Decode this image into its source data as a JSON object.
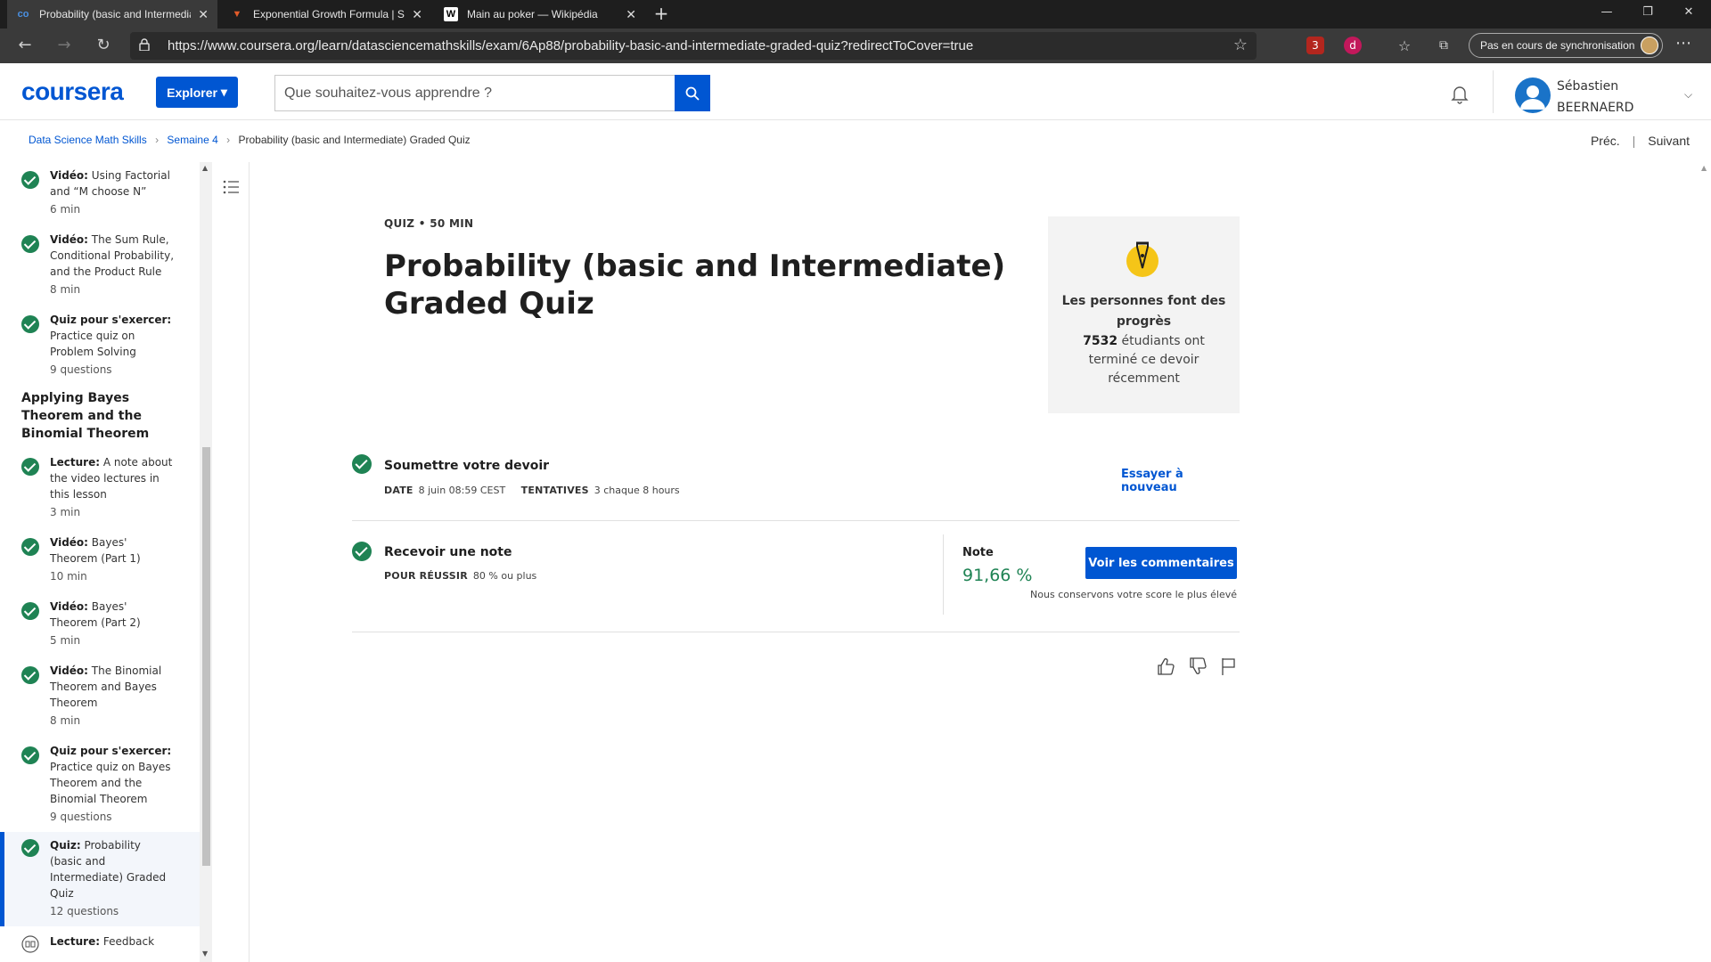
{
  "browser": {
    "tabs": [
      {
        "label": "Probability (basic and Intermedia",
        "favicon": "coursera-icon"
      },
      {
        "label": "Exponential Growth Formula | St",
        "favicon": "study-icon"
      },
      {
        "label": "Main au poker — Wikipédia",
        "favicon": "wikipedia-icon"
      }
    ],
    "url": "https://www.coursera.org/learn/datasciencemathskills/exam/6Ap88/probability-basic-and-intermediate-graded-quiz?redirectToCover=true",
    "extension_badge": "3",
    "sync_label": "Pas en cours de synchronisation"
  },
  "header": {
    "logo": "coursera",
    "explore_label": "Explorer",
    "search_placeholder": "Que souhaitez-vous apprendre ?",
    "user_first": "Sébastien",
    "user_last": "BEERNAERD"
  },
  "breadcrumb": {
    "course": "Data Science Math Skills",
    "week": "Semaine 4",
    "current": "Probability (basic and Intermediate) Graded Quiz"
  },
  "nav": {
    "prev": "Préc.",
    "next": "Suivant"
  },
  "sidebar": {
    "section_title": "Applying Bayes Theorem and the Binomial Theorem",
    "items": [
      {
        "type": "Vidéo:",
        "title": "Using Factorial and “M choose N”",
        "meta": "6  min"
      },
      {
        "type": "Vidéo:",
        "title": "The Sum Rule, Conditional Probability, and the Product Rule",
        "meta": "8  min"
      },
      {
        "type": "Quiz pour s'exercer:",
        "title": "Practice quiz on Problem Solving",
        "meta": "9 questions"
      },
      {
        "type": "Lecture:",
        "title": "A note about the video lectures in this lesson",
        "meta": "3  min"
      },
      {
        "type": "Vidéo:",
        "title": "Bayes' Theorem (Part 1)",
        "meta": "10  min"
      },
      {
        "type": "Vidéo:",
        "title": "Bayes' Theorem (Part 2)",
        "meta": "5  min"
      },
      {
        "type": "Vidéo:",
        "title": "The Binomial Theorem and Bayes Theorem",
        "meta": "8  min"
      },
      {
        "type": "Quiz pour s'exercer:",
        "title": "Practice quiz on Bayes Theorem and the Binomial Theorem",
        "meta": "9 questions"
      },
      {
        "type": "Quiz:",
        "title": "Probability (basic and Intermediate) Graded Quiz",
        "meta": "12 questions"
      },
      {
        "type": "Lecture:",
        "title": "Feedback",
        "meta": ""
      }
    ]
  },
  "quiz": {
    "kind": "QUIZ • 50  MIN",
    "title": "Probability (basic and Intermediate) Graded Quiz",
    "progress_title": "Les personnes font des progrès",
    "progress_count": "7532",
    "progress_text": "étudiants ont terminé ce devoir récemment",
    "submit_label": "Soumettre votre devoir",
    "date_label": "DATE",
    "date_value": "8 juin 08:59 CEST",
    "attempts_label": "TENTATIVES",
    "attempts_value": "3 chaque 8  hours",
    "retry_label": "Essayer à nouveau",
    "grade_label": "Recevoir une note",
    "pass_label": "POUR RÉUSSIR",
    "pass_value": "80 % ou plus",
    "note_label": "Note",
    "note_value": "91,66 %",
    "feedback_button": "Voir les commentaires",
    "keep_note": "Nous conservons votre score le plus élevé"
  },
  "colors": {
    "brand": "#0056d2",
    "success": "#1f8354"
  }
}
